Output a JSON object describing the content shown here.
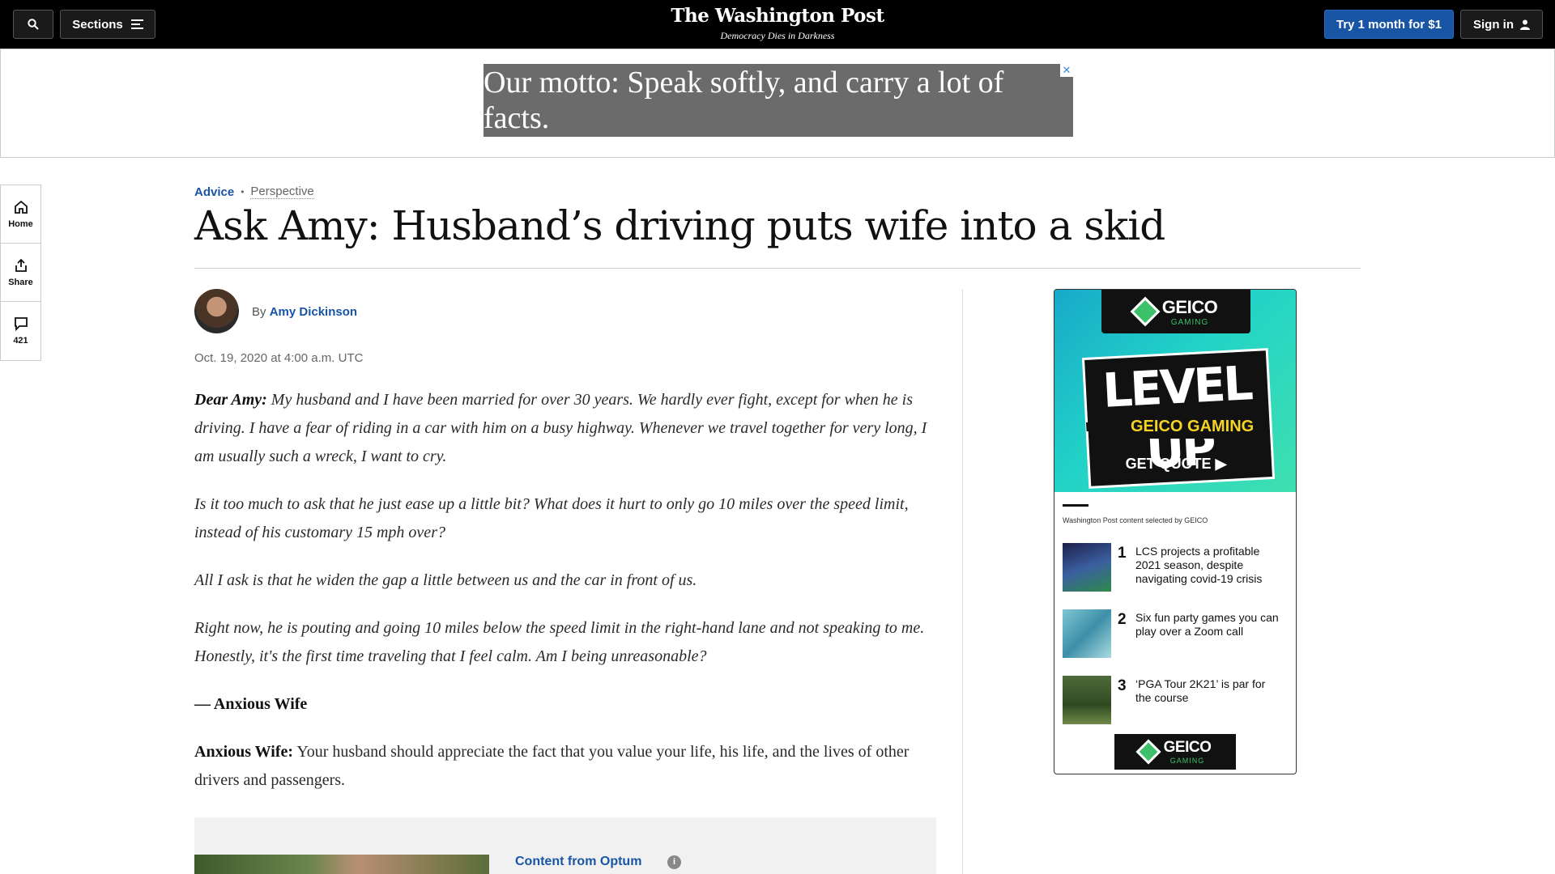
{
  "topbar": {
    "sections_label": "Sections",
    "brand_name": "The Washington Post",
    "tagline": "Democracy Dies in Darkness",
    "subscribe_label": "Try 1 month for $1",
    "signin_label": "Sign in"
  },
  "ad_banner": {
    "text": "Our motto: Speak softly, and carry a lot of facts.",
    "close_glyph": "✕"
  },
  "rail": {
    "home_label": "Home",
    "share_label": "Share",
    "comments_count": "421"
  },
  "article": {
    "section": "Advice",
    "kicker": "Perspective",
    "headline": "Ask Amy: Husband’s driving puts wife into a skid",
    "byline_prefix": "By",
    "author": "Amy Dickinson",
    "date": "Oct. 19, 2020 at 4:00 a.m. UTC",
    "paragraphs": {
      "p1_lead": "Dear Amy:",
      "p1_text": " My husband and I have been married for over 30 years. We hardly ever fight, except for when he is driving. I have a fear of riding in a car with him on a busy highway. Whenever we travel together for very long, I am usually such a wreck, I want to cry.",
      "p2": "Is it too much to ask that he just ease up a little bit? What does it hurt to only go 10 miles over the speed limit, instead of his customary 15 mph over?",
      "p3": "All I ask is that he widen the gap a little between us and the car in front of us.",
      "p4": "Right now, he is pouting and going 10 miles below the speed limit in the right-hand lane and not speaking to me. Honestly, it's the first time traveling that I feel calm. Am I being unreasonable?",
      "p5": "— Anxious Wife",
      "p6_lead": "Anxious Wife:",
      "p6_text": " Your husband should appreciate the fact that you value your life, his life, and the lives of other drivers and passengers."
    }
  },
  "sponsored": {
    "label": "Content from Optum",
    "info_glyph": "i"
  },
  "geico_ad": {
    "brand": "GEICO",
    "brand_sub": "GAMING",
    "level_up": "LEVEL UP",
    "with": "with",
    "geico_gaming": "GEICO GAMING",
    "cta": "GET QUOTE ▶",
    "note": "Washington Post content selected by GEICO",
    "items": [
      {
        "num": "1",
        "title": "LCS projects a profitable 2021 season, despite navigating covid-19 crisis"
      },
      {
        "num": "2",
        "title": "Six fun party games you can play over a Zoom call"
      },
      {
        "num": "3",
        "title": "‘PGA Tour 2K21’ is par for the course"
      }
    ]
  }
}
